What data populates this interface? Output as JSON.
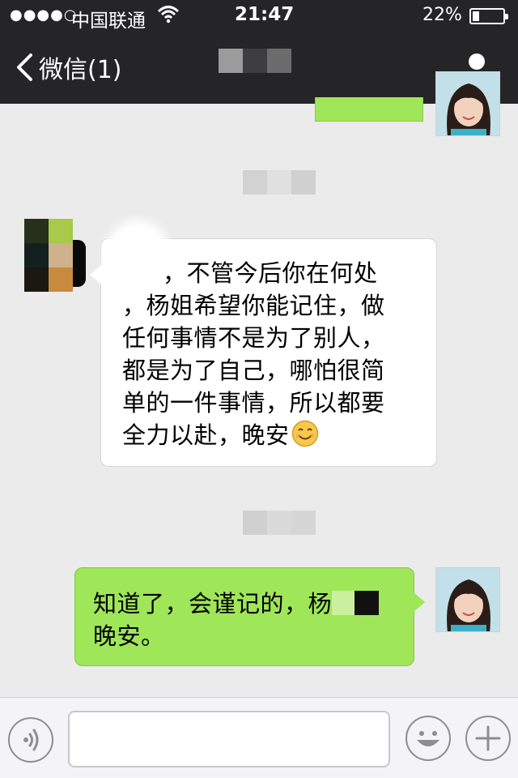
{
  "status_bar": {
    "signal": "●●●●○",
    "carrier": "中国联通",
    "time": "21:47",
    "battery_percent": "22%",
    "battery_level": 0.22
  },
  "nav": {
    "back_label": "微信(1)",
    "back_icon": "chevron-left-icon",
    "profile_icon": "person-icon"
  },
  "messages": [
    {
      "direction": "incoming",
      "lines": [
        "，不管今后你在何处",
        "，杨姐希望你能记住，做",
        "任何事情不是为了别人，",
        "都是为了自己，哪怕很简",
        "单的一件事情，所以都要",
        "全力以赴，晚安"
      ],
      "emoji": "smiley-icon"
    },
    {
      "direction": "outgoing",
      "lines": [
        "知道了，会谨记的，杨",
        "晚安。"
      ]
    }
  ],
  "colors": {
    "header_bg": "#252527",
    "chat_bg": "#ebebeb",
    "outgoing_bubble": "#9fe658",
    "incoming_bubble": "#ffffff"
  }
}
